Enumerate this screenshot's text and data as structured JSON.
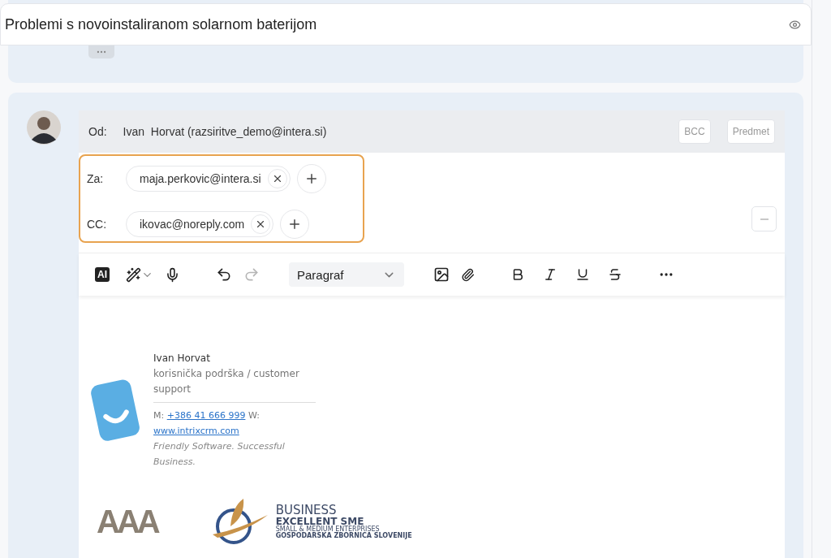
{
  "title": "Problemi s novoinstaliranom solarnom baterijom",
  "compose": {
    "from_label": "Od:",
    "from_value": "Ivan  Horvat (razsiritve_demo@intera.si)",
    "header_buttons": [
      "BCC",
      "Predmet"
    ],
    "recipients": [
      {
        "label": "Za:",
        "addresses": [
          "maja.perkovic@intera.si"
        ]
      },
      {
        "label": "CC:",
        "addresses": [
          "ikovac@noreply.com"
        ]
      }
    ],
    "toolbar": {
      "ai_label": "AI",
      "undo_disabled": false,
      "redo_disabled": true,
      "block_style": "Paragraf"
    }
  },
  "signature": {
    "name": "Ivan Horvat",
    "role": "korisnička podrška / customer support",
    "phone_label": "M:",
    "phone": "+386 41 666 999",
    "web_label": "W:",
    "web": "www.intrixcrm.com",
    "tagline": "Friendly Software. Successful Business.",
    "aaa_logo": "AAA",
    "business_logo": [
      "BUSINESS",
      "EXCELLENT SME",
      "SMALL & MEDIUM ENTERPRISES",
      "GOSPODARSKA ZBORNICA SLOVENIJE"
    ]
  }
}
